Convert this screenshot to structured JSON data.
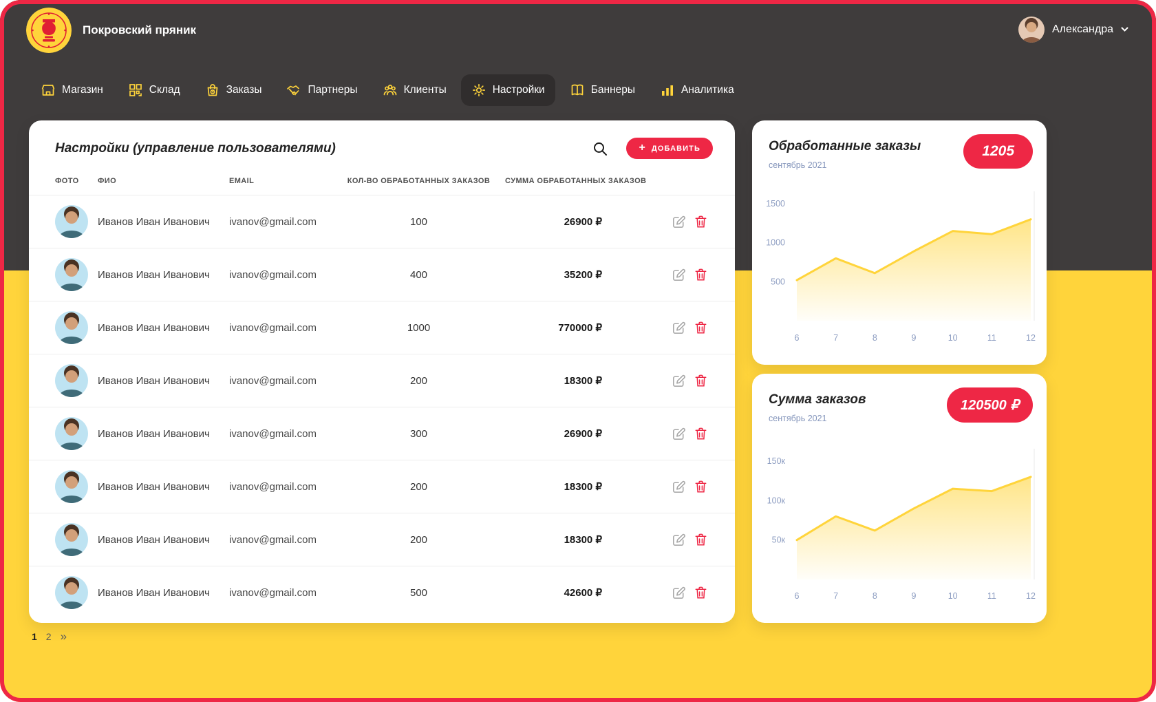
{
  "header": {
    "brand": "Покровский пряник",
    "user_name": "Александра",
    "logo_icon": "brand-samovar-logo",
    "user_chevron_icon": "chevron-down-icon"
  },
  "nav": {
    "items": [
      {
        "label": "Магазин",
        "icon": "store-icon",
        "active": false
      },
      {
        "label": "Склад",
        "icon": "warehouse-icon",
        "active": false
      },
      {
        "label": "Заказы",
        "icon": "orders-icon",
        "active": false
      },
      {
        "label": "Партнеры",
        "icon": "partners-icon",
        "active": false
      },
      {
        "label": "Клиенты",
        "icon": "clients-icon",
        "active": false
      },
      {
        "label": "Настройки",
        "icon": "settings-icon",
        "active": true
      },
      {
        "label": "Баннеры",
        "icon": "banners-icon",
        "active": false
      },
      {
        "label": "Аналитика",
        "icon": "analytics-icon",
        "active": false
      }
    ]
  },
  "main": {
    "title": "Настройки (управление пользователями)",
    "search_icon": "search-icon",
    "add_button_label": "ДОБАВИТЬ",
    "table": {
      "headers": [
        "ФОТО",
        "ФИО",
        "EMAIL",
        "КОЛ-ВО ОБРАБОТАННЫХ ЗАКАЗОВ",
        "СУММА ОБРАБОТАННЫХ ЗАКАЗОВ"
      ],
      "rows": [
        {
          "name": "Иванов Иван Иванович",
          "email": "ivanov@gmail.com",
          "count": "100",
          "sum": "26900 ₽"
        },
        {
          "name": "Иванов Иван Иванович",
          "email": "ivanov@gmail.com",
          "count": "400",
          "sum": "35200 ₽"
        },
        {
          "name": "Иванов Иван Иванович",
          "email": "ivanov@gmail.com",
          "count": "1000",
          "sum": "770000 ₽"
        },
        {
          "name": "Иванов Иван Иванович",
          "email": "ivanov@gmail.com",
          "count": "200",
          "sum": "18300 ₽"
        },
        {
          "name": "Иванов Иван Иванович",
          "email": "ivanov@gmail.com",
          "count": "300",
          "sum": "26900 ₽"
        },
        {
          "name": "Иванов Иван Иванович",
          "email": "ivanov@gmail.com",
          "count": "200",
          "sum": "18300 ₽"
        },
        {
          "name": "Иванов Иван Иванович",
          "email": "ivanov@gmail.com",
          "count": "200",
          "sum": "18300 ₽"
        },
        {
          "name": "Иванов Иван Иванович",
          "email": "ivanov@gmail.com",
          "count": "500",
          "sum": "42600 ₽"
        }
      ]
    },
    "pagination": {
      "pages": [
        "1",
        "2"
      ],
      "current_page": "1",
      "next_label": "»"
    }
  },
  "side": {
    "cards": [
      {
        "title": "Обработанные заказы",
        "badge": "1205",
        "subtitle": "сентябрь 2021",
        "chart_data": {
          "type": "area",
          "x": [
            6,
            7,
            8,
            9,
            10,
            11,
            12
          ],
          "values": [
            520,
            800,
            610,
            890,
            1150,
            1110,
            1300
          ],
          "ylim": [
            0,
            1500
          ],
          "yticks": [
            {
              "v": 500,
              "label": "500"
            },
            {
              "v": 1000,
              "label": "1000"
            },
            {
              "v": 1500,
              "label": "1500"
            }
          ],
          "line_color": "#FFD43B"
        }
      },
      {
        "title": "Сумма заказов",
        "badge": "120500 ₽",
        "subtitle": "сентябрь 2021",
        "chart_data": {
          "type": "area",
          "x": [
            6,
            7,
            8,
            9,
            10,
            11,
            12
          ],
          "values": [
            50000,
            80000,
            62000,
            90000,
            115000,
            112000,
            130000
          ],
          "ylim": [
            0,
            150000
          ],
          "yticks": [
            {
              "v": 50000,
              "label": "50к"
            },
            {
              "v": 100000,
              "label": "100к"
            },
            {
              "v": 150000,
              "label": "150к"
            }
          ],
          "line_color": "#FFD43B"
        }
      }
    ]
  },
  "colors": {
    "accent_red": "#EE2745",
    "brand_yellow": "#FFD43B",
    "header_dark": "#3F3C3C",
    "axis_label": "#8E9EC2"
  }
}
